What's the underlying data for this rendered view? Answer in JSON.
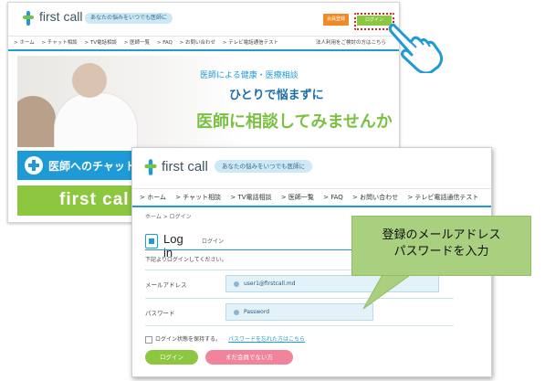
{
  "back_window": {
    "brand": "first call",
    "tagline": "あなたの悩みをいつでも医師に",
    "register_button": "会員登録",
    "login_button": "ログイン",
    "nav_items": [
      "> ホーム",
      "> チャット相談",
      "> TV電話相談",
      "> 医師一覧",
      "> FAQ",
      "> お問い合わせ",
      "> テレビ電話通信テスト"
    ],
    "corporate_link": "法人利用をご検討の方はこちら",
    "hero": {
      "line1": "医師による健康・医療相談",
      "line2": "ひとりで悩まずに",
      "line3": "医師に相談してみませんか"
    },
    "chat_banner": "医師へのチャット相",
    "footer_brand": "first cal"
  },
  "front_window": {
    "brand": "first call",
    "tagline": "あなたの悩みをいつでも医師に",
    "nav_items": [
      "> ホーム",
      "> チャット相談",
      "> TV電話相談",
      "> 医師一覧",
      "> FAQ",
      "> お問い合わせ",
      "> テレビ電話通信テスト"
    ],
    "breadcrumb": "ホーム > ログイン",
    "title_en": "Log in",
    "title_ja": "ログイン",
    "description": "下記よりログインしてください。",
    "email_label": "メールアドレス",
    "email_value": "user1@firstcall.md",
    "password_label": "パスワード",
    "password_value": "Password",
    "remember_label": "ログイン状態を保持する。",
    "forgot_link": "パスワードを忘れた方はこちら",
    "login_button": "ログイン",
    "not_member_button": "まだ会員でない方"
  },
  "callout": {
    "line1": "登録のメールアドレス",
    "line2": "パスワードを入力"
  },
  "colors": {
    "brand_blue": "#1e9ad6",
    "brand_green": "#8dc63f",
    "orange": "#f08a24",
    "pink": "#f0849a",
    "callout_green": "#a9d07f"
  }
}
